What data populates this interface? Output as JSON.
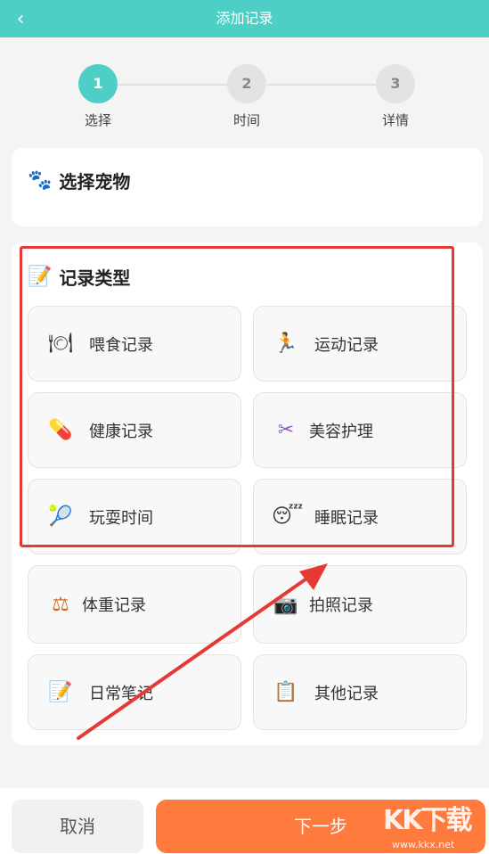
{
  "header": {
    "title": "添加记录",
    "back_icon": "back-chevron-icon"
  },
  "steps": [
    {
      "number": "1",
      "label": "选择",
      "active": true
    },
    {
      "number": "2",
      "label": "时间",
      "active": false
    },
    {
      "number": "3",
      "label": "详情",
      "active": false
    }
  ],
  "pet_section": {
    "icon": "paw-icon",
    "title": "选择宠物"
  },
  "record_section": {
    "icon": "memo-icon",
    "title": "记录类型",
    "types": [
      {
        "label": "喂食记录",
        "icon": "plate-cutlery-icon",
        "glyph": "🍽"
      },
      {
        "label": "运动记录",
        "icon": "running-icon",
        "glyph": "🏃"
      },
      {
        "label": "健康记录",
        "icon": "pill-icon",
        "glyph": "💊"
      },
      {
        "label": "美容护理",
        "icon": "scissors-icon",
        "glyph": "✂"
      },
      {
        "label": "玩耍时间",
        "icon": "tennis-icon",
        "glyph": "🎾"
      },
      {
        "label": "睡眠记录",
        "icon": "sleeping-face-icon",
        "glyph": "😴"
      },
      {
        "label": "体重记录",
        "icon": "scales-icon",
        "glyph": "⚖"
      },
      {
        "label": "拍照记录",
        "icon": "camera-icon",
        "glyph": "📷"
      },
      {
        "label": "日常笔记",
        "icon": "memo-icon",
        "glyph": "📝"
      },
      {
        "label": "其他记录",
        "icon": "clipboard-icon",
        "glyph": "📋"
      }
    ]
  },
  "footer": {
    "cancel_label": "取消",
    "next_label": "下一步"
  },
  "watermark": {
    "main": "KK下载",
    "sub": "www.kkx.net"
  },
  "colors": {
    "accent": "#4ecfc5",
    "next_button": "#ff7a3d",
    "annotation": "#e53935"
  }
}
